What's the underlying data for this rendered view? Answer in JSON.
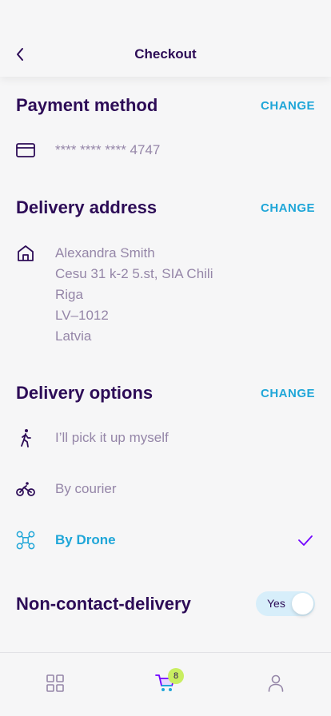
{
  "header": {
    "title": "Checkout",
    "back_icon": "chevron-left-icon"
  },
  "payment": {
    "title": "Payment method",
    "change_label": "CHANGE",
    "card_icon": "credit-card-icon",
    "card_number": "**** **** **** 4747"
  },
  "delivery_address": {
    "title": "Delivery address",
    "change_label": "CHANGE",
    "icon": "home-icon",
    "lines": [
      "Alexandra Smith",
      "Cesu 31 k-2 5.st, SIA Chili",
      "Riga",
      "LV–1012",
      "Latvia"
    ]
  },
  "delivery_options": {
    "title": "Delivery options",
    "change_label": "CHANGE",
    "options": [
      {
        "label": "I’ll pick it up myself",
        "icon": "walking-person-icon",
        "selected": false
      },
      {
        "label": "By courier",
        "icon": "bicycle-icon",
        "selected": false
      },
      {
        "label": "By Drone",
        "icon": "drone-icon",
        "selected": true
      }
    ],
    "check_icon": "checkmark-icon"
  },
  "non_contact": {
    "title": "Non-contact-delivery",
    "toggle_label": "Yes",
    "enabled": true
  },
  "tabbar": {
    "items": [
      {
        "name": "grid-icon"
      },
      {
        "name": "cart-icon",
        "badge": "8"
      },
      {
        "name": "user-icon"
      }
    ]
  },
  "colors": {
    "primary_text": "#2D0C57",
    "secondary_text": "#9586A8",
    "accent_blue": "#1FA6D8",
    "check_purple": "#7203FF",
    "badge_green": "#C9EE61",
    "toggle_bg": "#D7EEFA"
  }
}
